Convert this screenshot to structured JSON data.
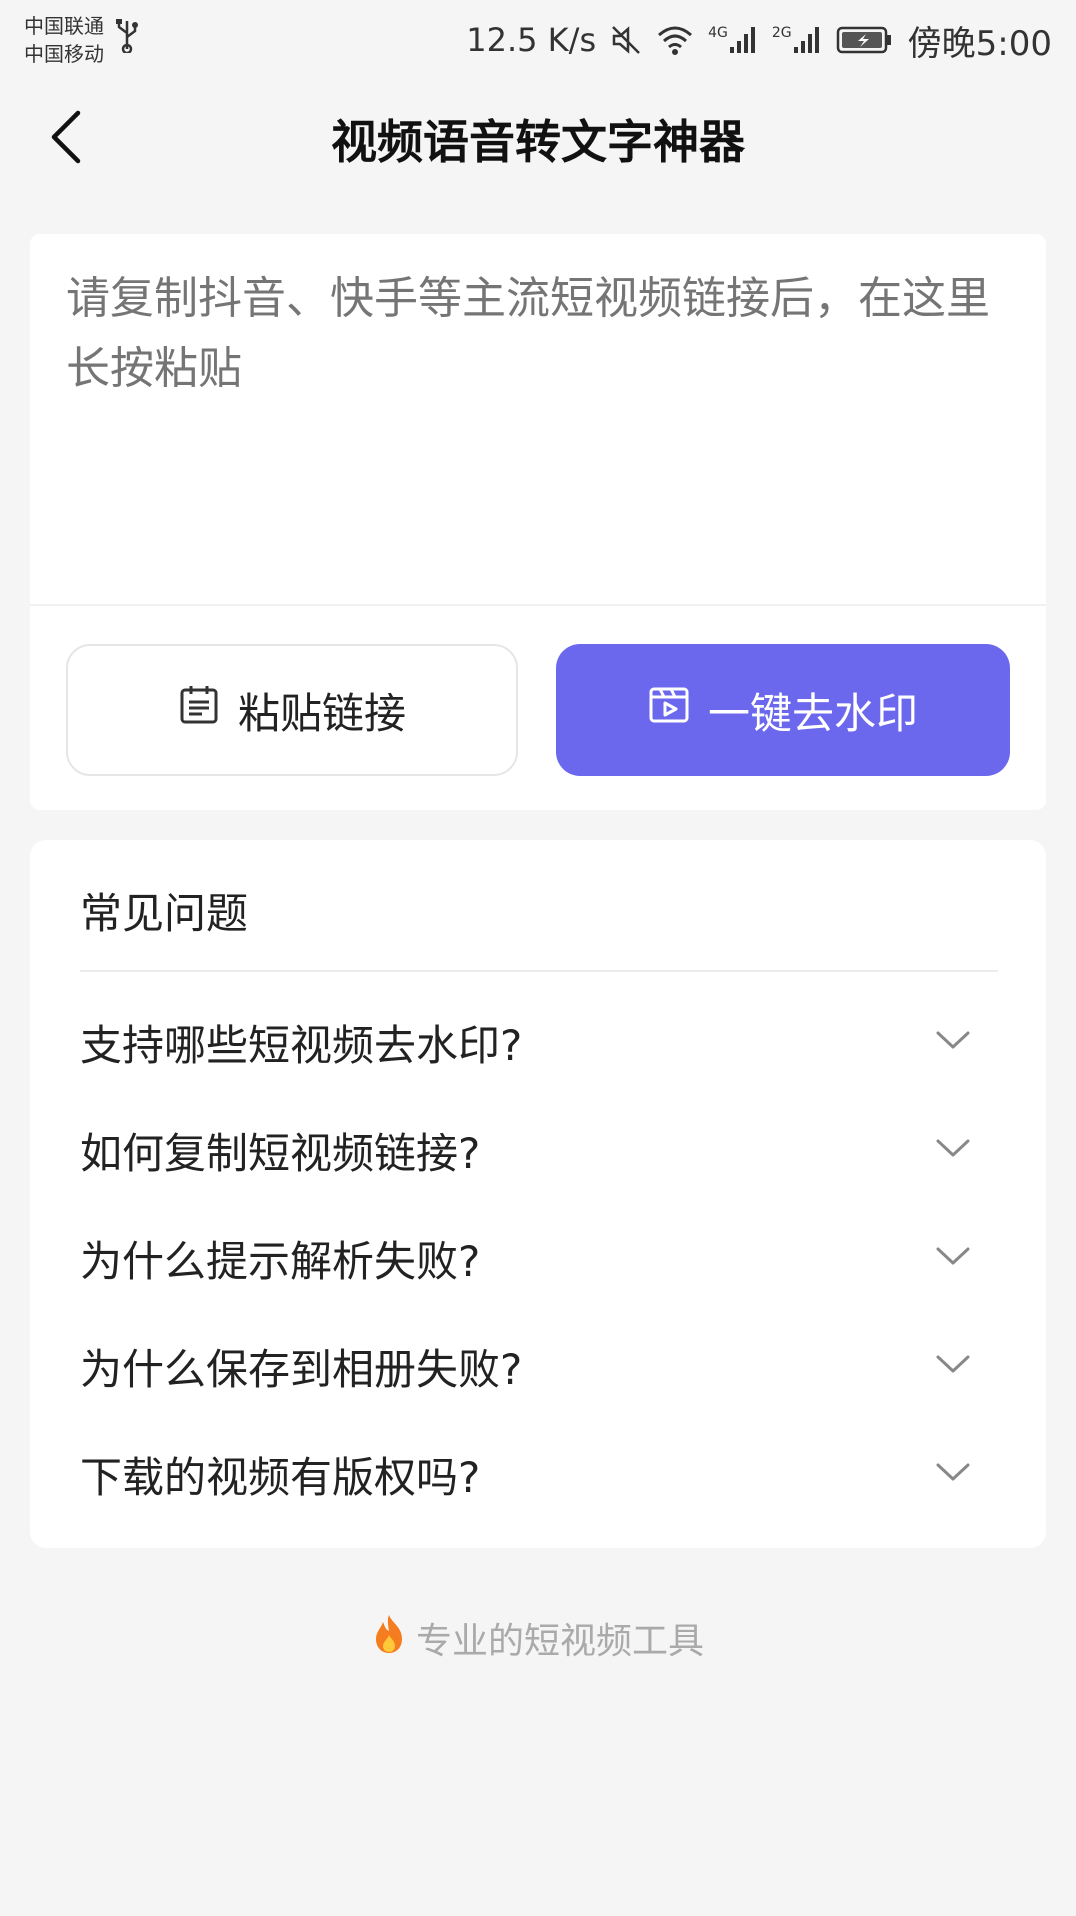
{
  "status_bar": {
    "carrier_1": "中国联通",
    "carrier_2": "中国移动",
    "net_speed": "12.5 K/s",
    "net_4g": "4G",
    "net_2g": "2G",
    "time": "傍晚5:00",
    "icons": [
      "usb-icon",
      "mute-icon",
      "wifi-icon",
      "signal-icon",
      "battery-icon"
    ]
  },
  "nav": {
    "title": "视频语音转文字神器",
    "back_icon": "chevron-left-icon"
  },
  "input_card": {
    "placeholder": "请复制抖音、快手等主流短视频链接后，在这里长按粘贴",
    "paste_button": "粘贴链接",
    "remove_watermark_button": "一键去水印",
    "accent_color": "#6b68ee"
  },
  "faq": {
    "heading": "常见问题",
    "items": [
      {
        "question": "支持哪些短视频去水印?"
      },
      {
        "question": "如何复制短视频链接?"
      },
      {
        "question": "为什么提示解析失败?"
      },
      {
        "question": "为什么保存到相册失败?"
      },
      {
        "question": "下载的视频有版权吗?"
      }
    ]
  },
  "footer": {
    "text": "专业的短视频工具",
    "icon": "fire-icon"
  }
}
